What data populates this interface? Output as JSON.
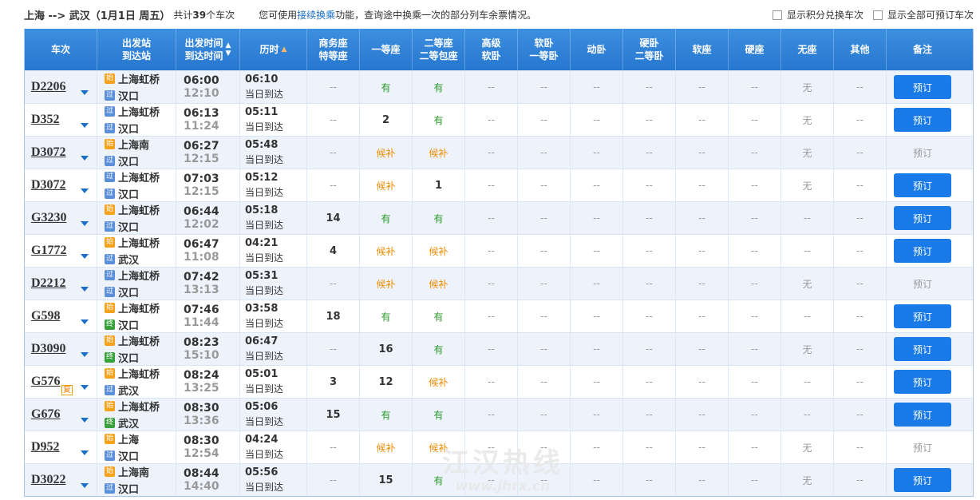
{
  "header": {
    "route": "上海 --> 武汉（1月1日 周五）",
    "count_prefix": "共计",
    "count": "39",
    "count_suffix": "个车次",
    "hint_pre": "您可使用",
    "hint_link": "接续换乘",
    "hint_post": "功能，查询途中换乘一次的部分列车余票情况。",
    "check1": "显示积分兑换车次",
    "check2": "显示全部可预订车次"
  },
  "columns": {
    "train": "车次",
    "station": "出发站\n到达站",
    "time": "出发时间\n到达时间",
    "duration": "历时",
    "business": "商务座\n特等座",
    "first": "一等座",
    "second": "二等座\n二等包座",
    "adv_soft_sleeper": "高级\n软卧",
    "soft_sleeper": "软卧\n一等卧",
    "moving_sleeper": "动卧",
    "hard_sleeper": "硬卧\n二等卧",
    "soft_seat": "软座",
    "hard_seat": "硬座",
    "no_seat": "无座",
    "other": "其他",
    "note": "备注"
  },
  "book_label": "预订",
  "rows": [
    {
      "train": "D2206",
      "from": "上海虹桥",
      "from_tag": "始",
      "to": "汉口",
      "to_tag": "过",
      "dep": "06:00",
      "arr": "12:10",
      "dur": "06:10",
      "day": "当日到达",
      "seats": [
        "--",
        "有",
        "有",
        "--",
        "--",
        "--",
        "--",
        "--",
        "--",
        "无",
        "--"
      ],
      "bookable": true
    },
    {
      "train": "D352",
      "from": "上海虹桥",
      "from_tag": "过",
      "to": "汉口",
      "to_tag": "过",
      "dep": "06:13",
      "arr": "11:24",
      "dur": "05:11",
      "day": "当日到达",
      "seats": [
        "--",
        "2",
        "有",
        "--",
        "--",
        "--",
        "--",
        "--",
        "--",
        "无",
        "--"
      ],
      "bookable": true
    },
    {
      "train": "D3072",
      "from": "上海南",
      "from_tag": "始",
      "to": "汉口",
      "to_tag": "过",
      "dep": "06:27",
      "arr": "12:15",
      "dur": "05:48",
      "day": "当日到达",
      "seats": [
        "--",
        "候补",
        "候补",
        "--",
        "--",
        "--",
        "--",
        "--",
        "--",
        "无",
        "--"
      ],
      "bookable": false
    },
    {
      "train": "D3072",
      "from": "上海虹桥",
      "from_tag": "过",
      "to": "汉口",
      "to_tag": "过",
      "dep": "07:03",
      "arr": "12:15",
      "dur": "05:12",
      "day": "当日到达",
      "seats": [
        "--",
        "候补",
        "1",
        "--",
        "--",
        "--",
        "--",
        "--",
        "--",
        "无",
        "--"
      ],
      "bookable": true
    },
    {
      "train": "G3230",
      "from": "上海虹桥",
      "from_tag": "始",
      "to": "汉口",
      "to_tag": "过",
      "dep": "06:44",
      "arr": "12:02",
      "dur": "05:18",
      "day": "当日到达",
      "seats": [
        "14",
        "有",
        "有",
        "--",
        "--",
        "--",
        "--",
        "--",
        "--",
        "--",
        "--"
      ],
      "bookable": true
    },
    {
      "train": "G1772",
      "from": "上海虹桥",
      "from_tag": "始",
      "to": "武汉",
      "to_tag": "过",
      "dep": "06:47",
      "arr": "11:08",
      "dur": "04:21",
      "day": "当日到达",
      "seats": [
        "4",
        "候补",
        "候补",
        "--",
        "--",
        "--",
        "--",
        "--",
        "--",
        "--",
        "--"
      ],
      "bookable": true
    },
    {
      "train": "D2212",
      "from": "上海虹桥",
      "from_tag": "过",
      "to": "汉口",
      "to_tag": "过",
      "dep": "07:42",
      "arr": "13:13",
      "dur": "05:31",
      "day": "当日到达",
      "seats": [
        "--",
        "候补",
        "候补",
        "--",
        "--",
        "--",
        "--",
        "--",
        "--",
        "无",
        "--"
      ],
      "bookable": false
    },
    {
      "train": "G598",
      "from": "上海虹桥",
      "from_tag": "始",
      "to": "汉口",
      "to_tag": "终",
      "dep": "07:46",
      "arr": "11:44",
      "dur": "03:58",
      "day": "当日到达",
      "seats": [
        "18",
        "有",
        "有",
        "--",
        "--",
        "--",
        "--",
        "--",
        "--",
        "--",
        "--"
      ],
      "bookable": true
    },
    {
      "train": "D3090",
      "from": "上海虹桥",
      "from_tag": "始",
      "to": "汉口",
      "to_tag": "终",
      "dep": "08:23",
      "arr": "15:10",
      "dur": "06:47",
      "day": "当日到达",
      "seats": [
        "--",
        "16",
        "有",
        "--",
        "--",
        "--",
        "--",
        "--",
        "--",
        "无",
        "--"
      ],
      "bookable": true
    },
    {
      "train": "G576",
      "fu": "复",
      "from": "上海虹桥",
      "from_tag": "始",
      "to": "武汉",
      "to_tag": "过",
      "dep": "08:24",
      "arr": "13:25",
      "dur": "05:01",
      "day": "当日到达",
      "seats": [
        "3",
        "12",
        "候补",
        "--",
        "--",
        "--",
        "--",
        "--",
        "--",
        "--",
        "--"
      ],
      "bookable": true
    },
    {
      "train": "G676",
      "from": "上海虹桥",
      "from_tag": "始",
      "to": "武汉",
      "to_tag": "终",
      "dep": "08:30",
      "arr": "13:36",
      "dur": "05:06",
      "day": "当日到达",
      "seats": [
        "15",
        "有",
        "有",
        "--",
        "--",
        "--",
        "--",
        "--",
        "--",
        "--",
        "--"
      ],
      "bookable": true
    },
    {
      "train": "D952",
      "from": "上海",
      "from_tag": "始",
      "to": "汉口",
      "to_tag": "过",
      "dep": "08:30",
      "arr": "12:54",
      "dur": "04:24",
      "day": "当日到达",
      "seats": [
        "--",
        "候补",
        "候补",
        "--",
        "--",
        "--",
        "--",
        "--",
        "--",
        "无",
        "--"
      ],
      "bookable": false
    },
    {
      "train": "D3022",
      "from": "上海南",
      "from_tag": "始",
      "to": "汉口",
      "to_tag": "过",
      "dep": "08:44",
      "arr": "14:40",
      "dur": "05:56",
      "day": "当日到达",
      "seats": [
        "--",
        "15",
        "有",
        "--",
        "--",
        "--",
        "--",
        "--",
        "--",
        "无",
        "--"
      ],
      "bookable": true
    }
  ],
  "watermark": {
    "line1": "江汉热线",
    "line2": "www.jhrx.cn"
  }
}
